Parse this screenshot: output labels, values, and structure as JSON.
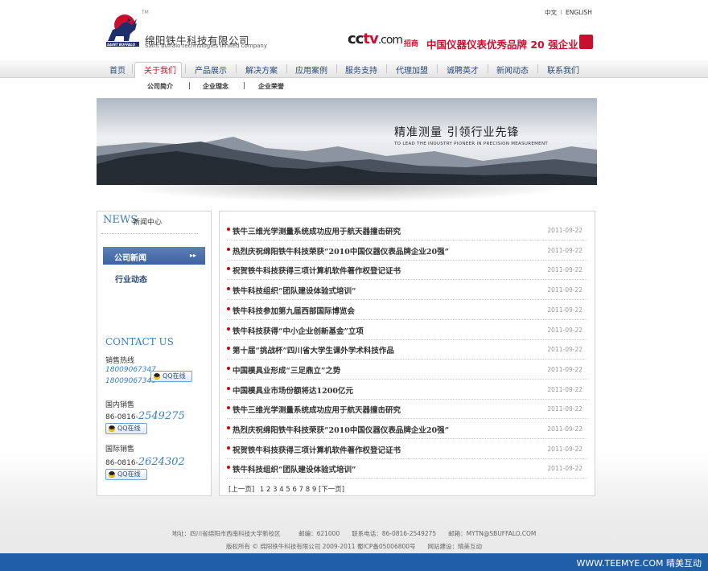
{
  "header": {
    "company_cn": "绵阳铁牛科技有限公司",
    "company_en": "Saint buffalo technologies limited company",
    "logo_caption": "SAINT BUFFALO",
    "tm": "TM",
    "lang_cn": "中文",
    "lang_sep": "I",
    "lang_en": "ENGLISH",
    "cctv_a": "cc",
    "cctv_b": "tv",
    "cctv_c": ".com",
    "recruit": "招商",
    "slogan": "中国仪器仪表优秀品牌 20 强企业"
  },
  "nav": {
    "items": [
      "首页",
      "关于我们",
      "产品展示",
      "解决方案",
      "应用案例",
      "服务支持",
      "代理加盟",
      "诚聘英才",
      "新闻动态",
      "联系我们"
    ],
    "active": "关于我们"
  },
  "subnav": {
    "items": [
      "公司简介",
      "企业理念",
      "企业荣誉"
    ],
    "sep": "|"
  },
  "banner": {
    "title": "精准测量 引领行业先锋",
    "subtitle": "TO LEAD THE INDUSTRY PIONEER IN PRECISION MEASUREMENT"
  },
  "sidebar": {
    "news_en": "NEWS",
    "news_cn": "新闻中心",
    "items": [
      "公司新闻",
      "行业动态"
    ],
    "arrow": "▸▸",
    "contact_en": "CONTACT US",
    "sales_hotline_label": "销售热线",
    "phone1": "18009067347",
    "phone2": "18009067348",
    "domestic_label": "国内销售",
    "domestic_prefix": "86-0816-",
    "domestic_num": "2549275",
    "intl_label": "国际销售",
    "intl_prefix": "86-0816-",
    "intl_num": "2624302",
    "qq_label": "QQ在线"
  },
  "news": {
    "rows": [
      {
        "title": "铁牛三维光学测量系统成功应用于航天器撞击研究",
        "date": "2011-09-22"
      },
      {
        "title": "热烈庆祝绵阳铁牛科技荣获“2010中国仪器仪表品牌企业20强”",
        "date": "2011-09-22"
      },
      {
        "title": "祝贺铁牛科技获得三项计算机软件著作权登记证书",
        "date": "2011-09-22"
      },
      {
        "title": "铁牛科技组织“团队建设体验式培训”",
        "date": "2011-09-22"
      },
      {
        "title": "铁牛科技参加第九届西部国际博览会",
        "date": "2011-09-22"
      },
      {
        "title": "铁牛科技获得“中小企业创新基金”立项",
        "date": "2011-09-22"
      },
      {
        "title": "第十届“挑战杯”四川省大学生课外学术科技作品",
        "date": "2011-09-22"
      },
      {
        "title": "中国模具业形成“三足鼎立”之势",
        "date": "2011-09-22"
      },
      {
        "title": "中国模具业市场份额将达1200亿元",
        "date": "2011-09-22"
      },
      {
        "title": "铁牛三维光学测量系统成功应用于航天器撞击研究",
        "date": "2011-09-22"
      },
      {
        "title": "热烈庆祝绵阳铁牛科技荣获“2010中国仪器仪表品牌企业20强”",
        "date": "2011-09-22"
      },
      {
        "title": "祝贺铁牛科技获得三项计算机软件著作权登记证书",
        "date": "2011-09-22"
      },
      {
        "title": "铁牛科技组织“团队建设体验式培训”",
        "date": "2011-09-22"
      }
    ],
    "pager_prev": "[上一页]",
    "pages": [
      "1",
      "2",
      "3",
      "4",
      "5",
      "6",
      "7",
      "8",
      "9"
    ],
    "pager_next": "[下一页]"
  },
  "footer": {
    "line1": "地址：四川省绵阳市西南科技大学新校区　　　邮编：621000　　联系电话：86-0816-2549275　　邮箱：MYTN@SBUFFALO.COM",
    "line2": "版权所有 © 绵阳铁牛科技有限公司 2009-2011 蜀ICP备05006800号　　网站建设：晴美互动",
    "bottom": "WWW.TEEMYE.COM  晴美互动"
  },
  "colors": {
    "brand_blue": "#1f5fa8",
    "accent_red": "#c8102e",
    "link_navy": "#2a4a78",
    "light_blue": "#3a7fc3"
  }
}
